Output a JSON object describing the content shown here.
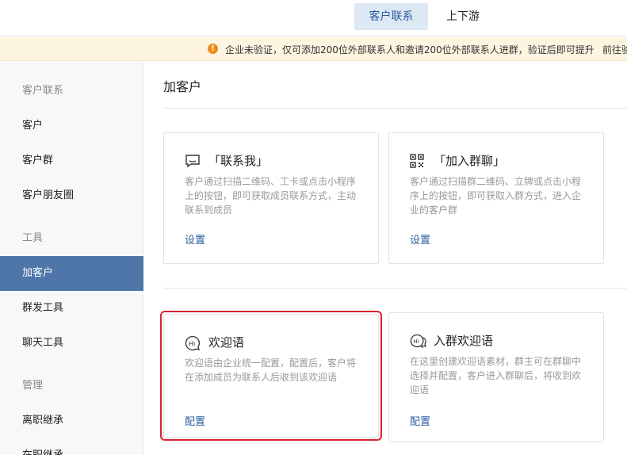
{
  "header": {
    "tabs": [
      {
        "label": "客户联系",
        "active": true
      },
      {
        "label": "上下游",
        "active": false
      }
    ]
  },
  "notice": {
    "icon": "info-icon",
    "text": "企业未验证，仅可添加200位外部联系人和邀请200位外部联系人进群，验证后即可提升",
    "link": "前往验证"
  },
  "sidebar": {
    "items": [
      {
        "label": "客户联系",
        "type": "group"
      },
      {
        "label": "客户",
        "type": "item"
      },
      {
        "label": "客户群",
        "type": "item"
      },
      {
        "label": "客户朋友圈",
        "type": "item"
      },
      {
        "label": "工具",
        "type": "group"
      },
      {
        "label": "加客户",
        "type": "item",
        "active": true
      },
      {
        "label": "群发工具",
        "type": "item"
      },
      {
        "label": "聊天工具",
        "type": "item"
      },
      {
        "label": "管理",
        "type": "group"
      },
      {
        "label": "离职继承",
        "type": "item"
      },
      {
        "label": "在职继承",
        "type": "item"
      }
    ]
  },
  "main": {
    "title": "加客户",
    "cards": [
      {
        "icon": "chat-bubble-icon",
        "title": "「联系我」",
        "desc": "客户通过扫描二维码、工卡或点击小程序上的按钮，即可获取成员联系方式，主动联系到成员",
        "link": "设置"
      },
      {
        "icon": "qr-code-icon",
        "title": "「加入群聊」",
        "desc": "客户通过扫描群二维码、立牌或点击小程序上的按钮，即可获取入群方式，进入企业的客户群",
        "link": "设置"
      },
      {
        "icon": "hi-bubble-icon",
        "title": "欢迎语",
        "desc": "欢迎语由企业统一配置，配置后，客户将在添加成员为联系人后收到该欢迎语",
        "link": "配置"
      },
      {
        "icon": "hi-group-bubble-icon",
        "title": "入群欢迎语",
        "desc": "在这里创建欢迎语素材，群主可在群聊中选择并配置，客户进入群聊后，将收到欢迎语",
        "link": "配置"
      }
    ]
  },
  "colors": {
    "accent": "#4f76a9",
    "link": "#2b5c9e",
    "notice_bg": "#fdf5e0",
    "warning": "#f18a1b",
    "highlight": "#d9232d"
  }
}
